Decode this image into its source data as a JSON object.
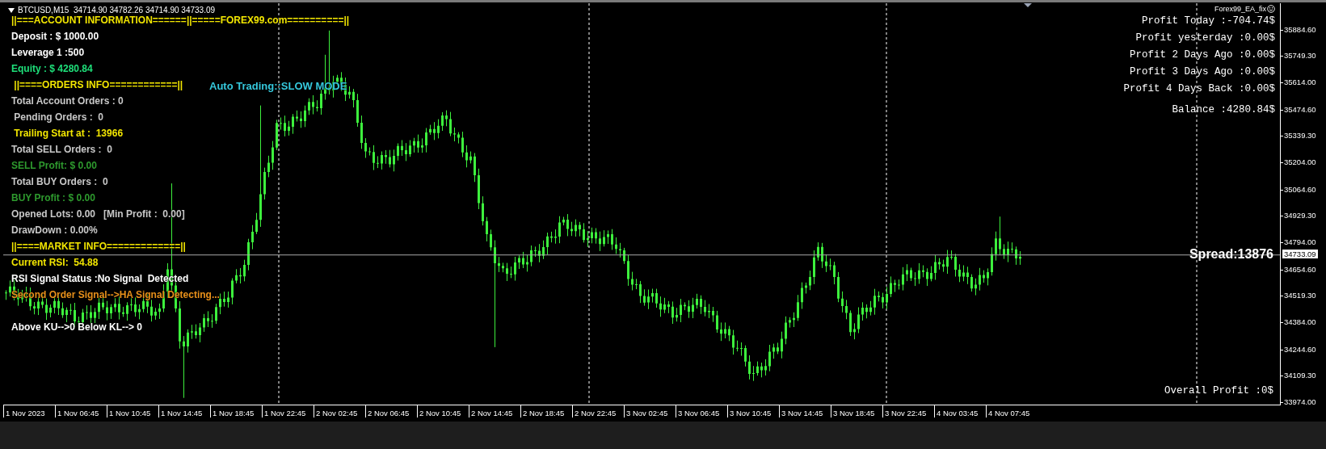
{
  "header": "BTCUSD,M15  34714.90 34782.26 34714.90 34733.09",
  "ea_name": "Forex99_EA_fix",
  "info_lines": [
    {
      "text": "||===ACCOUNT INFORMATION======||=====FOREX99.com==========||",
      "color": "#f2e600",
      "kind": "line"
    },
    {
      "text": "Deposit : $ 1000.00",
      "color": "#ffffff",
      "kind": "line"
    },
    {
      "text": "Leverage 1 :500",
      "color": "#ffffff",
      "kind": "line"
    },
    {
      "text": "Equity : $ 4280.84",
      "color": "#1ee07a",
      "kind": "line"
    },
    {
      "text": " ||====ORDERS INFO============||",
      "color": "#f2e600",
      "kind": "line"
    },
    {
      "text": "Total Account Orders : 0",
      "color": "#c8c8c8",
      "kind": "line"
    },
    {
      "text": " Pending Orders :  0",
      "color": "#c8c8c8",
      "kind": "line"
    },
    {
      "text": " Trailing Start at :  13966",
      "color": "#f2e600",
      "kind": "line"
    },
    {
      "text": "Total SELL Orders :  0",
      "color": "#c8c8c8",
      "kind": "line"
    },
    {
      "text": "SELL Profit: $ 0.00",
      "color": "#2e9a2e",
      "kind": "line"
    },
    {
      "text": "Total BUY Orders :  0",
      "color": "#c8c8c8",
      "kind": "line"
    },
    {
      "text": "BUY Profit : $ 0.00",
      "color": "#2e9a2e",
      "kind": "line"
    },
    {
      "text": "Opened Lots: 0.00   [Min Profit :  0.00]",
      "color": "#c8c8c8",
      "kind": "line"
    },
    {
      "text": "DrawDown : 0.00%",
      "color": "#c8c8c8",
      "kind": "line"
    },
    {
      "text": "||====MARKET INFO=============||",
      "color": "#f2e600",
      "kind": "line"
    },
    {
      "text": "Current RSI:  54.88",
      "color": "#f2e600",
      "kind": "line"
    },
    {
      "text": "RSI Signal Status :No Signal  Detected",
      "color": "#ffffff",
      "kind": "line"
    },
    {
      "text": "Second Order Signal-->HA Signal Detecting...",
      "color": "#e8901a",
      "kind": "line"
    },
    {
      "text": "Above KU-->0 Below KL--> 0",
      "color": "#ffffff",
      "kind": "spaced"
    }
  ],
  "auto_trading": "Auto Trading::SLOW MODE",
  "profit_lines": [
    "Profit Today :-704.74$",
    "Profit yesterday :0.00$",
    "Profit 2 Days Ago :0.00$",
    "Profit 3 Days Ago :0.00$",
    "Profit 4 Days Back :0.00$",
    "Balance :4280.84$"
  ],
  "spread": "Spread:13876",
  "overall_profit": "Overall Profit :0$",
  "price_axis": {
    "ticks": [
      "35884.60",
      "35749.30",
      "35614.00",
      "35474.60",
      "35339.30",
      "35204.00",
      "35064.60",
      "34929.30",
      "34794.00",
      "34654.60",
      "34519.30",
      "34384.00",
      "34244.60",
      "34109.30",
      "33974.00"
    ],
    "current": "34733.09"
  },
  "time_axis": [
    "1 Nov 2023",
    "1 Nov 06:45",
    "1 Nov 10:45",
    "1 Nov 14:45",
    "1 Nov 18:45",
    "1 Nov 22:45",
    "2 Nov 02:45",
    "2 Nov 06:45",
    "2 Nov 10:45",
    "2 Nov 14:45",
    "2 Nov 18:45",
    "2 Nov 22:45",
    "3 Nov 02:45",
    "3 Nov 06:45",
    "3 Nov 10:45",
    "3 Nov 14:45",
    "3 Nov 18:45",
    "3 Nov 22:45",
    "4 Nov 03:45",
    "4 Nov 07:45"
  ]
}
